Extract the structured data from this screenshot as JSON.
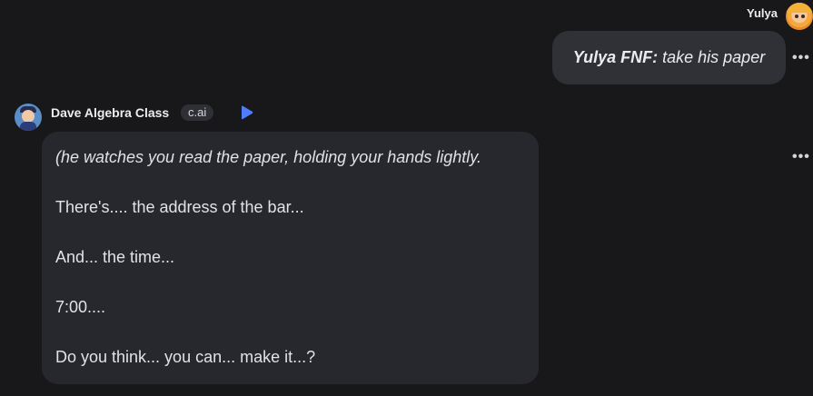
{
  "user": {
    "name": "Yulya",
    "message_speaker": "Yulya FNF:",
    "message_text": "take his paper"
  },
  "bot": {
    "name": "Dave Algebra Class",
    "badge": "c.ai",
    "message_lines": [
      "(he watches you read the paper, holding your hands lightly.",
      "There's.... the address of the bar...",
      "And... the time...",
      "7:00....",
      "Do you think... you can... make it...?"
    ]
  },
  "icons": {
    "user_avatar": "user-avatar-icon",
    "bot_avatar": "bot-avatar-icon",
    "play": "play-icon",
    "more": "more-options-icon"
  },
  "colors": {
    "background": "#18181b",
    "user_bubble": "#303136",
    "bot_bubble": "#27282d",
    "accent_play": "#4f7cff"
  }
}
